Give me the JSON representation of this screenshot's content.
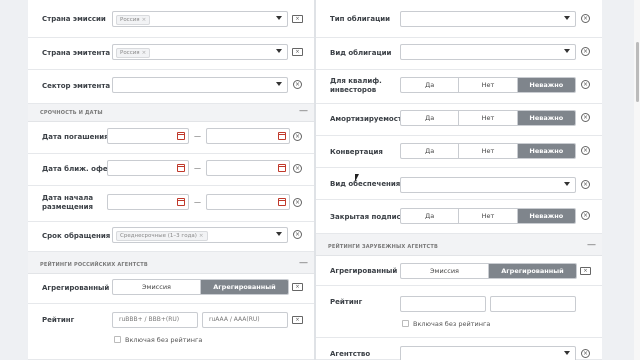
{
  "left": {
    "issuer_country": {
      "label": "Страна эмиссии",
      "chip": "Россия"
    },
    "emitter_country": {
      "label": "Страна эмитента",
      "chip": "Россия"
    },
    "emitter_sector": {
      "label": "Сектор эмитента"
    },
    "dates_section": {
      "title": "СРОЧНОСТЬ И ДАТЫ",
      "toggle": "—"
    },
    "maturity": {
      "label": "Дата погашения",
      "sep": "—"
    },
    "offer": {
      "label": "Дата ближ. оферты",
      "sep": "—"
    },
    "placement": {
      "label": "Дата начала размещения",
      "sep": "—"
    },
    "term": {
      "label": "Срок обращения",
      "chip": "Среднесрочные (1–3 года)"
    },
    "rus_ratings": {
      "title": "РЕЙТИНГИ РОССИЙСКИХ АГЕНТСТВ",
      "toggle": "—"
    },
    "aggregated": {
      "label": "Агрегированный",
      "opt1": "Эмиссия",
      "opt2": "Агрегированный"
    },
    "rating": {
      "label": "Рейтинг",
      "from": "ruBBB+ / BBB+(RU)",
      "to": "ruAAA / AAA(RU)",
      "no_rating": "Включая без рейтинга"
    }
  },
  "right": {
    "bond_type": {
      "label": "Тип облигации"
    },
    "bond_kind": {
      "label": "Вид облигации"
    },
    "qual": {
      "label": "Для квалиф. инвесторов",
      "yes": "Да",
      "no": "Нет",
      "any": "Неважно"
    },
    "amort": {
      "label": "Амортизируемость",
      "yes": "Да",
      "no": "Нет",
      "any": "Неважно"
    },
    "conv": {
      "label": "Конвертация",
      "yes": "Да",
      "no": "Нет",
      "any": "Неважно"
    },
    "security": {
      "label": "Вид обеспечения"
    },
    "closed": {
      "label": "Закрытая подписка",
      "yes": "Да",
      "no": "Нет",
      "any": "Неважно"
    },
    "foreign_ratings": {
      "title": "РЕЙТИНГИ ЗАРУБЕЖНЫХ АГЕНТСТВ",
      "toggle": "—"
    },
    "aggregated": {
      "label": "Агрегированный",
      "opt1": "Эмиссия",
      "opt2": "Агрегированный"
    },
    "rating": {
      "label": "Рейтинг",
      "no_rating": "Включая без рейтинга"
    },
    "agency": {
      "label": "Агентство"
    }
  }
}
